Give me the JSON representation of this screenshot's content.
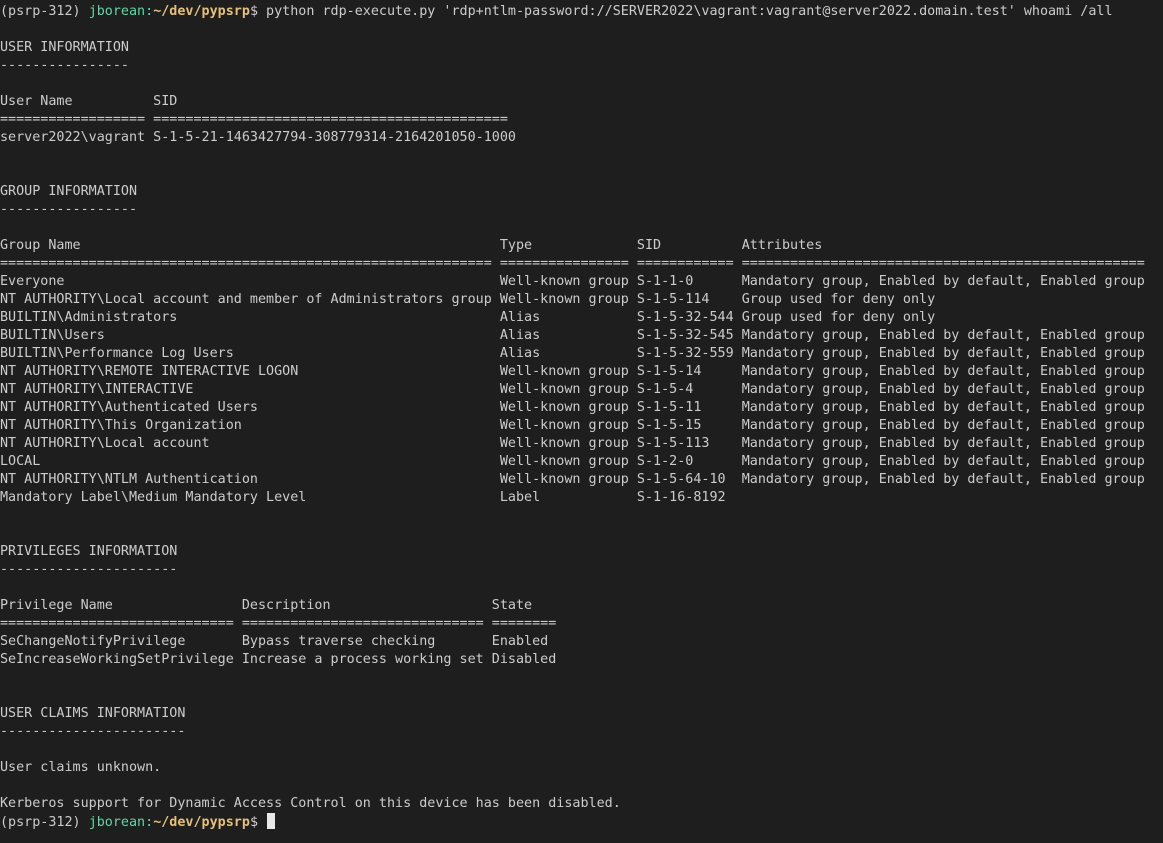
{
  "colors": {
    "background": "#1e1e1e",
    "text": "#cccccc",
    "user": "#5fd7a7",
    "path": "#e5c07b"
  },
  "prompt": {
    "venv": "(psrp-312)",
    "user": "jborean:",
    "path": "~/dev/pypsrp",
    "symbol": "$"
  },
  "command": " python rdp-execute.py 'rdp+ntlm-password://SERVER2022\\vagrant:vagrant@server2022.domain.test' whoami /all",
  "output_lines": [
    "",
    "USER INFORMATION",
    "----------------",
    "",
    "User Name          SID",
    "================== ============================================",
    "server2022\\vagrant S-1-5-21-1463427794-308779314-2164201050-1000",
    "",
    "",
    "GROUP INFORMATION",
    "-----------------",
    "",
    "Group Name                                                    Type             SID          Attributes",
    "============================================================= ================ ============ ==================================================",
    "Everyone                                                      Well-known group S-1-1-0      Mandatory group, Enabled by default, Enabled group",
    "NT AUTHORITY\\Local account and member of Administrators group Well-known group S-1-5-114    Group used for deny only",
    "BUILTIN\\Administrators                                        Alias            S-1-5-32-544 Group used for deny only",
    "BUILTIN\\Users                                                 Alias            S-1-5-32-545 Mandatory group, Enabled by default, Enabled group",
    "BUILTIN\\Performance Log Users                                 Alias            S-1-5-32-559 Mandatory group, Enabled by default, Enabled group",
    "NT AUTHORITY\\REMOTE INTERACTIVE LOGON                         Well-known group S-1-5-14     Mandatory group, Enabled by default, Enabled group",
    "NT AUTHORITY\\INTERACTIVE                                      Well-known group S-1-5-4      Mandatory group, Enabled by default, Enabled group",
    "NT AUTHORITY\\Authenticated Users                              Well-known group S-1-5-11     Mandatory group, Enabled by default, Enabled group",
    "NT AUTHORITY\\This Organization                                Well-known group S-1-5-15     Mandatory group, Enabled by default, Enabled group",
    "NT AUTHORITY\\Local account                                    Well-known group S-1-5-113    Mandatory group, Enabled by default, Enabled group",
    "LOCAL                                                         Well-known group S-1-2-0      Mandatory group, Enabled by default, Enabled group",
    "NT AUTHORITY\\NTLM Authentication                              Well-known group S-1-5-64-10  Mandatory group, Enabled by default, Enabled group",
    "Mandatory Label\\Medium Mandatory Level                        Label            S-1-16-8192",
    "",
    "",
    "PRIVILEGES INFORMATION",
    "----------------------",
    "",
    "Privilege Name                Description                    State",
    "============================= ============================== ========",
    "SeChangeNotifyPrivilege       Bypass traverse checking       Enabled",
    "SeIncreaseWorkingSetPrivilege Increase a process working set Disabled",
    "",
    "",
    "USER CLAIMS INFORMATION",
    "-----------------------",
    "",
    "User claims unknown.",
    "",
    "Kerberos support for Dynamic Access Control on this device has been disabled."
  ]
}
